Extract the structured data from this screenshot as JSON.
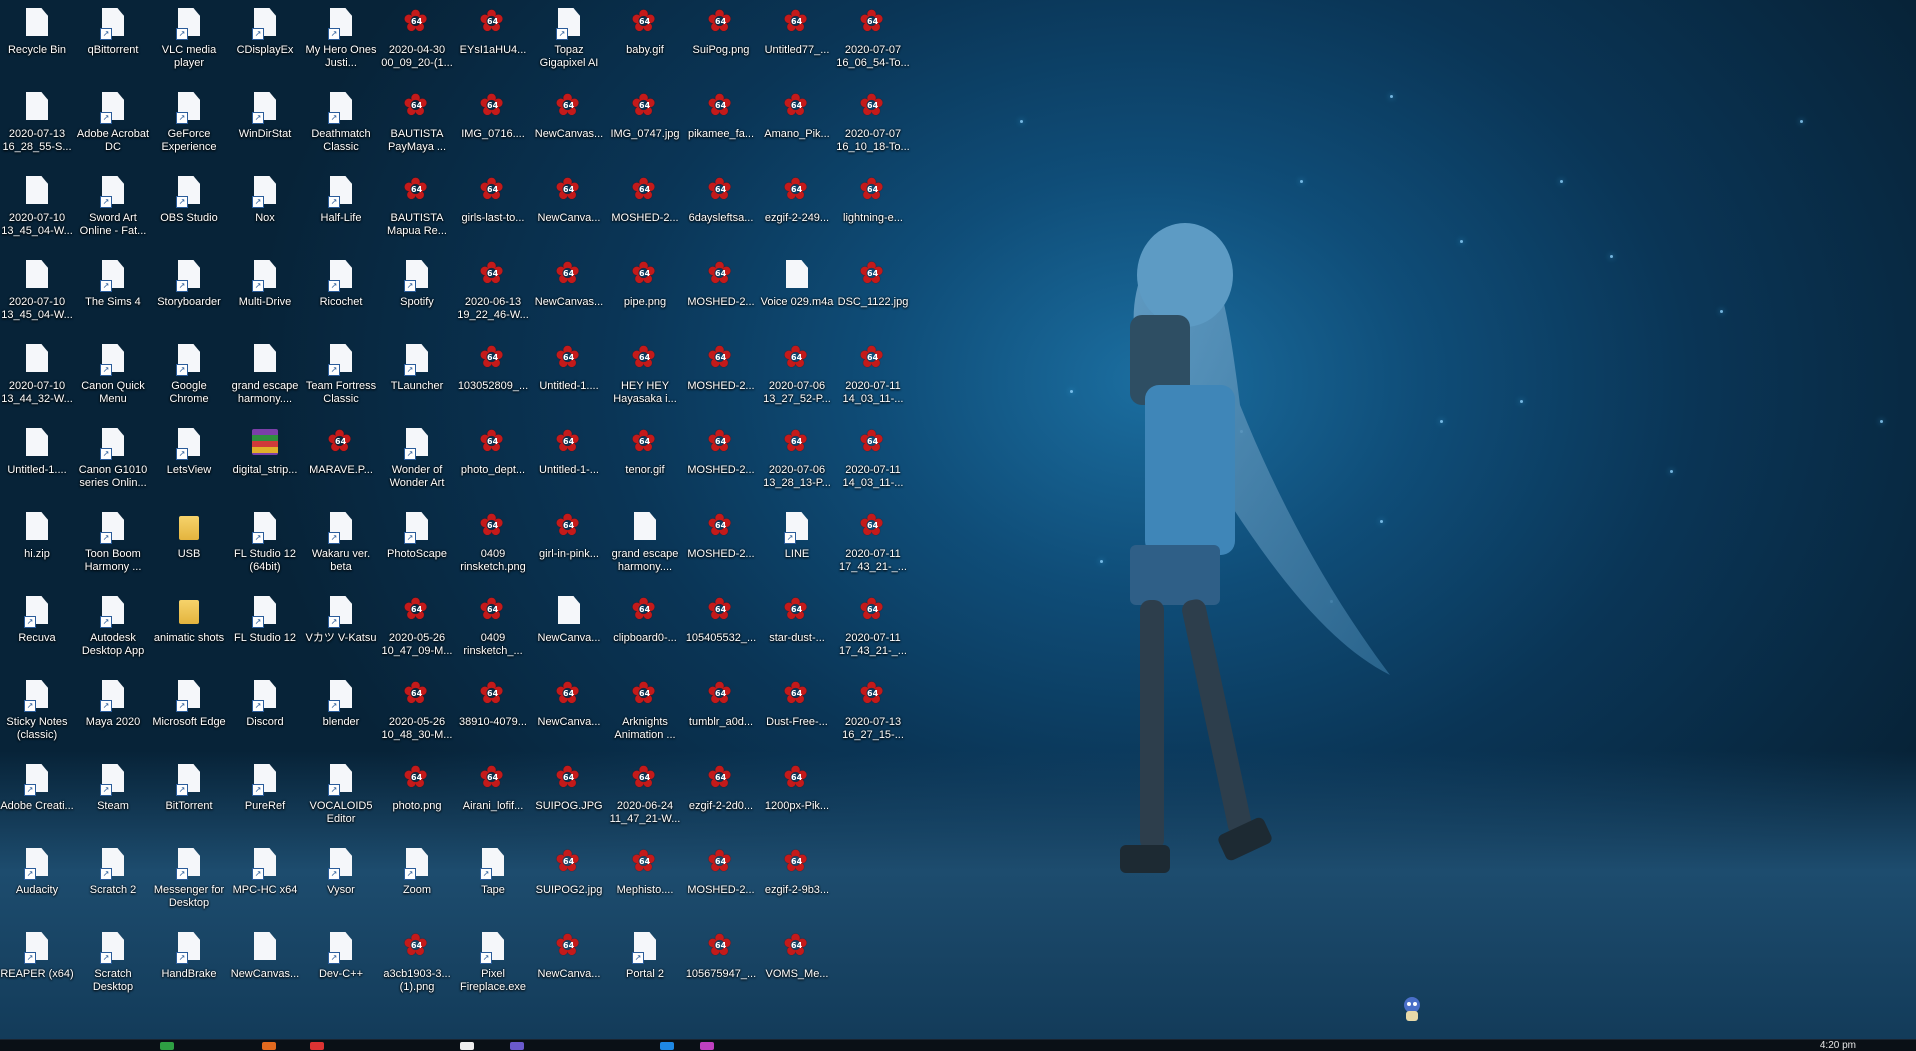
{
  "desktop": {
    "icons": [
      {
        "label": "Recycle Bin",
        "type": "doc"
      },
      {
        "label": "qBittorrent",
        "type": "shortcut"
      },
      {
        "label": "VLC media player",
        "type": "shortcut"
      },
      {
        "label": "CDisplayEx",
        "type": "shortcut"
      },
      {
        "label": "My Hero Ones Justi...",
        "type": "shortcut"
      },
      {
        "label": "2020-04-30 00_09_20-(1...",
        "type": "star"
      },
      {
        "label": "EYsI1aHU4...",
        "type": "star"
      },
      {
        "label": "Topaz Gigapixel AI",
        "type": "shortcut"
      },
      {
        "label": "baby.gif",
        "type": "star"
      },
      {
        "label": "SuiPog.png",
        "type": "star"
      },
      {
        "label": "Untitled77_...",
        "type": "star"
      },
      {
        "label": "2020-07-07 16_06_54-To...",
        "type": "star"
      },
      {
        "label": "2020-07-13 16_28_55-S...",
        "type": "doc"
      },
      {
        "label": "Adobe Acrobat DC",
        "type": "shortcut"
      },
      {
        "label": "GeForce Experience",
        "type": "shortcut"
      },
      {
        "label": "WinDirStat",
        "type": "shortcut"
      },
      {
        "label": "Deathmatch Classic",
        "type": "shortcut"
      },
      {
        "label": "BAUTISTA PayMaya ...",
        "type": "star"
      },
      {
        "label": "IMG_0716....",
        "type": "star"
      },
      {
        "label": "NewCanvas...",
        "type": "star"
      },
      {
        "label": "IMG_0747.jpg",
        "type": "star"
      },
      {
        "label": "pikamee_fa...",
        "type": "star"
      },
      {
        "label": "Amano_Pik...",
        "type": "star"
      },
      {
        "label": "2020-07-07 16_10_18-To...",
        "type": "star"
      },
      {
        "label": "2020-07-10 13_45_04-W...",
        "type": "doc"
      },
      {
        "label": "Sword Art Online - Fat...",
        "type": "shortcut"
      },
      {
        "label": "OBS Studio",
        "type": "shortcut"
      },
      {
        "label": "Nox",
        "type": "shortcut"
      },
      {
        "label": "Half-Life",
        "type": "shortcut"
      },
      {
        "label": "BAUTISTA Mapua Re...",
        "type": "star"
      },
      {
        "label": "girls-last-to...",
        "type": "star"
      },
      {
        "label": "NewCanva...",
        "type": "star"
      },
      {
        "label": "MOSHED-2...",
        "type": "star"
      },
      {
        "label": "6daysleftsa...",
        "type": "star"
      },
      {
        "label": "ezgif-2-249...",
        "type": "star"
      },
      {
        "label": "lightning-e...",
        "type": "star"
      },
      {
        "label": "2020-07-10 13_45_04-W...",
        "type": "doc"
      },
      {
        "label": "The Sims 4",
        "type": "shortcut"
      },
      {
        "label": "Storyboarder",
        "type": "shortcut"
      },
      {
        "label": "Multi-Drive",
        "type": "shortcut"
      },
      {
        "label": "Ricochet",
        "type": "shortcut"
      },
      {
        "label": "Spotify",
        "type": "shortcut"
      },
      {
        "label": "2020-06-13 19_22_46-W...",
        "type": "star"
      },
      {
        "label": "NewCanvas...",
        "type": "star"
      },
      {
        "label": "pipe.png",
        "type": "star"
      },
      {
        "label": "MOSHED-2...",
        "type": "star"
      },
      {
        "label": "Voice 029.m4a",
        "type": "doc"
      },
      {
        "label": "DSC_1122.jpg",
        "type": "star"
      },
      {
        "label": "2020-07-10 13_44_32-W...",
        "type": "doc"
      },
      {
        "label": "Canon Quick Menu",
        "type": "shortcut"
      },
      {
        "label": "Google Chrome",
        "type": "shortcut"
      },
      {
        "label": "grand escape harmony....",
        "type": "doc"
      },
      {
        "label": "Team Fortress Classic",
        "type": "shortcut"
      },
      {
        "label": "TLauncher",
        "type": "shortcut"
      },
      {
        "label": "103052809_...",
        "type": "star"
      },
      {
        "label": "Untitled-1....",
        "type": "star"
      },
      {
        "label": "HEY HEY Hayasaka i...",
        "type": "star"
      },
      {
        "label": "MOSHED-2...",
        "type": "star"
      },
      {
        "label": "2020-07-06 13_27_52-P...",
        "type": "star"
      },
      {
        "label": "2020-07-11 14_03_11-...",
        "type": "star"
      },
      {
        "label": "Untitled-1....",
        "type": "doc"
      },
      {
        "label": "Canon G1010 series Onlin...",
        "type": "shortcut"
      },
      {
        "label": "LetsView",
        "type": "shortcut"
      },
      {
        "label": "digital_strip...",
        "type": "archive"
      },
      {
        "label": "MARAVE.P...",
        "type": "star"
      },
      {
        "label": "Wonder of Wonder Art",
        "type": "shortcut"
      },
      {
        "label": "photo_dept...",
        "type": "star"
      },
      {
        "label": "Untitled-1-...",
        "type": "star"
      },
      {
        "label": "tenor.gif",
        "type": "star"
      },
      {
        "label": "MOSHED-2...",
        "type": "star"
      },
      {
        "label": "2020-07-06 13_28_13-P...",
        "type": "star"
      },
      {
        "label": "2020-07-11 14_03_11-...",
        "type": "star"
      },
      {
        "label": "hi.zip",
        "type": "doc"
      },
      {
        "label": "Toon Boom Harmony ...",
        "type": "shortcut"
      },
      {
        "label": "USB",
        "type": "folder"
      },
      {
        "label": "FL Studio 12 (64bit)",
        "type": "shortcut"
      },
      {
        "label": "Wakaru ver. beta",
        "type": "shortcut"
      },
      {
        "label": "PhotoScape",
        "type": "shortcut"
      },
      {
        "label": "0409 rinsketch.png",
        "type": "star"
      },
      {
        "label": "girl-in-pink...",
        "type": "star"
      },
      {
        "label": "grand escape harmony....",
        "type": "doc"
      },
      {
        "label": "MOSHED-2...",
        "type": "star"
      },
      {
        "label": "LINE",
        "type": "shortcut"
      },
      {
        "label": "2020-07-11 17_43_21-_...",
        "type": "star"
      },
      {
        "label": "Recuva",
        "type": "shortcut"
      },
      {
        "label": "Autodesk Desktop App",
        "type": "shortcut"
      },
      {
        "label": "animatic shots",
        "type": "folder"
      },
      {
        "label": "FL Studio 12",
        "type": "shortcut"
      },
      {
        "label": "Vカツ V-Katsu",
        "type": "shortcut"
      },
      {
        "label": "2020-05-26 10_47_09-M...",
        "type": "star"
      },
      {
        "label": "0409 rinsketch_...",
        "type": "star"
      },
      {
        "label": "NewCanva...",
        "type": "doc"
      },
      {
        "label": "clipboard0-...",
        "type": "star"
      },
      {
        "label": "105405532_...",
        "type": "star"
      },
      {
        "label": "star-dust-...",
        "type": "star"
      },
      {
        "label": "2020-07-11 17_43_21-_...",
        "type": "star"
      },
      {
        "label": "Sticky Notes (classic)",
        "type": "shortcut"
      },
      {
        "label": "Maya 2020",
        "type": "shortcut"
      },
      {
        "label": "Microsoft Edge",
        "type": "shortcut"
      },
      {
        "label": "Discord",
        "type": "shortcut"
      },
      {
        "label": "blender",
        "type": "shortcut"
      },
      {
        "label": "2020-05-26 10_48_30-M...",
        "type": "star"
      },
      {
        "label": "38910-4079...",
        "type": "star"
      },
      {
        "label": "NewCanva...",
        "type": "star"
      },
      {
        "label": "Arknights Animation ...",
        "type": "star"
      },
      {
        "label": "tumblr_a0d...",
        "type": "star"
      },
      {
        "label": "Dust-Free-...",
        "type": "star"
      },
      {
        "label": "2020-07-13 16_27_15-...",
        "type": "star"
      },
      {
        "label": "Adobe Creati...",
        "type": "shortcut"
      },
      {
        "label": "Steam",
        "type": "shortcut"
      },
      {
        "label": "BitTorrent",
        "type": "shortcut"
      },
      {
        "label": "PureRef",
        "type": "shortcut"
      },
      {
        "label": "VOCALOID5 Editor",
        "type": "shortcut"
      },
      {
        "label": "photo.png",
        "type": "star"
      },
      {
        "label": "Airani_lofif...",
        "type": "star"
      },
      {
        "label": "SUIPOG.JPG",
        "type": "star"
      },
      {
        "label": "2020-06-24 11_47_21-W...",
        "type": "star"
      },
      {
        "label": "ezgif-2-2d0...",
        "type": "star"
      },
      {
        "label": "1200px-Pik...",
        "type": "star"
      },
      {
        "label": "",
        "type": "none"
      },
      {
        "label": "Audacity",
        "type": "shortcut"
      },
      {
        "label": "Scratch 2",
        "type": "shortcut"
      },
      {
        "label": "Messenger for Desktop",
        "type": "shortcut"
      },
      {
        "label": "MPC-HC x64",
        "type": "shortcut"
      },
      {
        "label": "Vysor",
        "type": "shortcut"
      },
      {
        "label": "Zoom",
        "type": "shortcut"
      },
      {
        "label": "Tape",
        "type": "shortcut"
      },
      {
        "label": "SUIPOG2.jpg",
        "type": "star"
      },
      {
        "label": "Mephisto....",
        "type": "star"
      },
      {
        "label": "MOSHED-2...",
        "type": "star"
      },
      {
        "label": "ezgif-2-9b3...",
        "type": "star"
      },
      {
        "label": "",
        "type": "none"
      },
      {
        "label": "REAPER (x64)",
        "type": "shortcut"
      },
      {
        "label": "Scratch Desktop",
        "type": "shortcut"
      },
      {
        "label": "HandBrake",
        "type": "shortcut"
      },
      {
        "label": "NewCanvas...",
        "type": "doc"
      },
      {
        "label": "Dev-C++",
        "type": "shortcut"
      },
      {
        "label": "a3cb1903-3... (1).png",
        "type": "star"
      },
      {
        "label": "Pixel Fireplace.exe",
        "type": "shortcut"
      },
      {
        "label": "NewCanva...",
        "type": "star"
      },
      {
        "label": "Portal 2",
        "type": "shortcut"
      },
      {
        "label": "105675947_...",
        "type": "star"
      },
      {
        "label": "VOMS_Me...",
        "type": "star"
      },
      {
        "label": "",
        "type": "none"
      }
    ]
  },
  "taskbar": {
    "time": "4:20 pm"
  },
  "colors": {
    "star_red": "#c41a1a",
    "folder_yellow": "#f6d36b",
    "taskbar": "#0a1016"
  }
}
